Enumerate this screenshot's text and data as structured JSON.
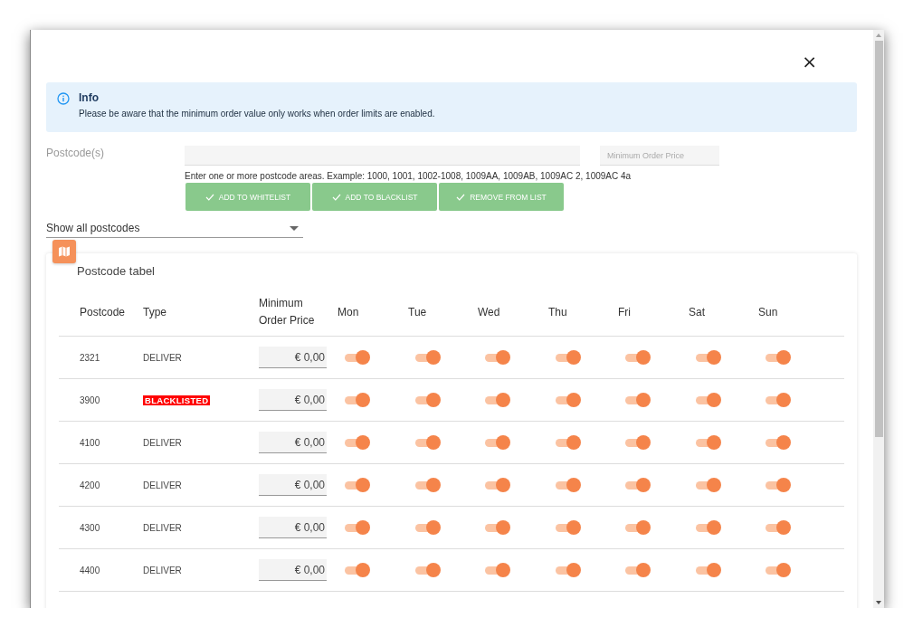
{
  "close_button": "×",
  "info": {
    "title": "Info",
    "message": "Please be aware that the minimum order value only works when order limits are enabled."
  },
  "form": {
    "label": "Postcode(s)",
    "price_field": {
      "placeholder": "Minimum Order Price"
    },
    "hint": "Enter one or more postcode areas. Example: 1000, 1001, 1002-1008, 1009AA, 1009AB, 1009AC 2, 1009AC 4a",
    "buttons": [
      "ADD TO WHITELIST",
      "ADD TO BLACKLIST",
      "REMOVE FROM LIST"
    ]
  },
  "filter": {
    "value": "Show all postcodes"
  },
  "table": {
    "title": "Postcode tabel",
    "columns": [
      "Postcode",
      "Type",
      "Minimum Order Price",
      "Mon",
      "Tue",
      "Wed",
      "Thu",
      "Fri",
      "Sat",
      "Sun"
    ],
    "rows": [
      {
        "postcode": "2321",
        "type": "DELIVER",
        "kind": "plain",
        "price": "€ 0,00",
        "days": [
          {
            "on": true
          },
          {
            "on": true
          },
          {
            "on": true
          },
          {
            "on": true
          },
          {
            "on": true
          },
          {
            "on": true
          },
          {
            "on": true
          }
        ]
      },
      {
        "postcode": "3900",
        "type": "BLACKLISTED",
        "kind": "badge",
        "price": "€ 0,00",
        "days": [
          {
            "on": true
          },
          {
            "on": true
          },
          {
            "on": true
          },
          {
            "on": true
          },
          {
            "on": true
          },
          {
            "on": true
          },
          {
            "on": true
          }
        ]
      },
      {
        "postcode": "4100",
        "type": "DELIVER",
        "kind": "plain",
        "price": "€ 0,00",
        "days": [
          {
            "on": true
          },
          {
            "on": true
          },
          {
            "on": true
          },
          {
            "on": true
          },
          {
            "on": true
          },
          {
            "on": true
          },
          {
            "on": true
          }
        ]
      },
      {
        "postcode": "4200",
        "type": "DELIVER",
        "kind": "plain",
        "price": "€ 0,00",
        "days": [
          {
            "on": true
          },
          {
            "on": true
          },
          {
            "on": true
          },
          {
            "on": true
          },
          {
            "on": true
          },
          {
            "on": true
          },
          {
            "on": true
          }
        ]
      },
      {
        "postcode": "4300",
        "type": "DELIVER",
        "kind": "plain",
        "price": "€ 0,00",
        "days": [
          {
            "on": true
          },
          {
            "on": true
          },
          {
            "on": true
          },
          {
            "on": true
          },
          {
            "on": true
          },
          {
            "on": true
          },
          {
            "on": true
          }
        ]
      },
      {
        "postcode": "4400",
        "type": "DELIVER",
        "kind": "plain",
        "price": "€ 0,00",
        "days": [
          {
            "on": true
          },
          {
            "on": true
          },
          {
            "on": true
          },
          {
            "on": true
          },
          {
            "on": true
          },
          {
            "on": true
          },
          {
            "on": true
          }
        ]
      }
    ]
  }
}
